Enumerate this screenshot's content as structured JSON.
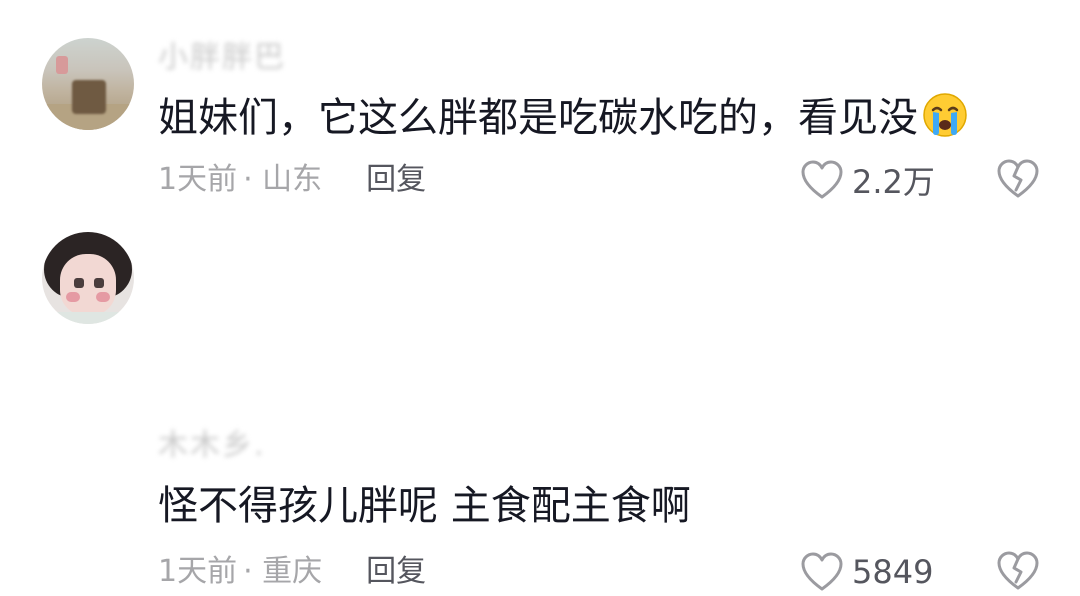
{
  "comments": [
    {
      "username": "小胖胖巴",
      "text": "姐妹们，它这么胖都是吃碳水吃的，看见没",
      "emoji": "crying-face-emoji",
      "time": "1天前",
      "location": "· 山东",
      "reply_label": "回复",
      "likes": "2.2万",
      "icons": {
        "like": "heart-outline-icon",
        "dislike": "broken-heart-icon"
      }
    },
    {
      "username": "木木乡.",
      "text": "怪不得孩儿胖呢 主食配主食啊",
      "emoji": "",
      "time": "1天前",
      "location": "· 重庆",
      "reply_label": "回复",
      "likes": "5849",
      "icons": {
        "like": "heart-outline-icon",
        "dislike": "broken-heart-icon"
      }
    }
  ],
  "colors": {
    "primary_text": "#161823",
    "secondary_text": "#a6a6a9",
    "action_text": "#55565e",
    "icon_stroke": "#9b9ba0"
  }
}
